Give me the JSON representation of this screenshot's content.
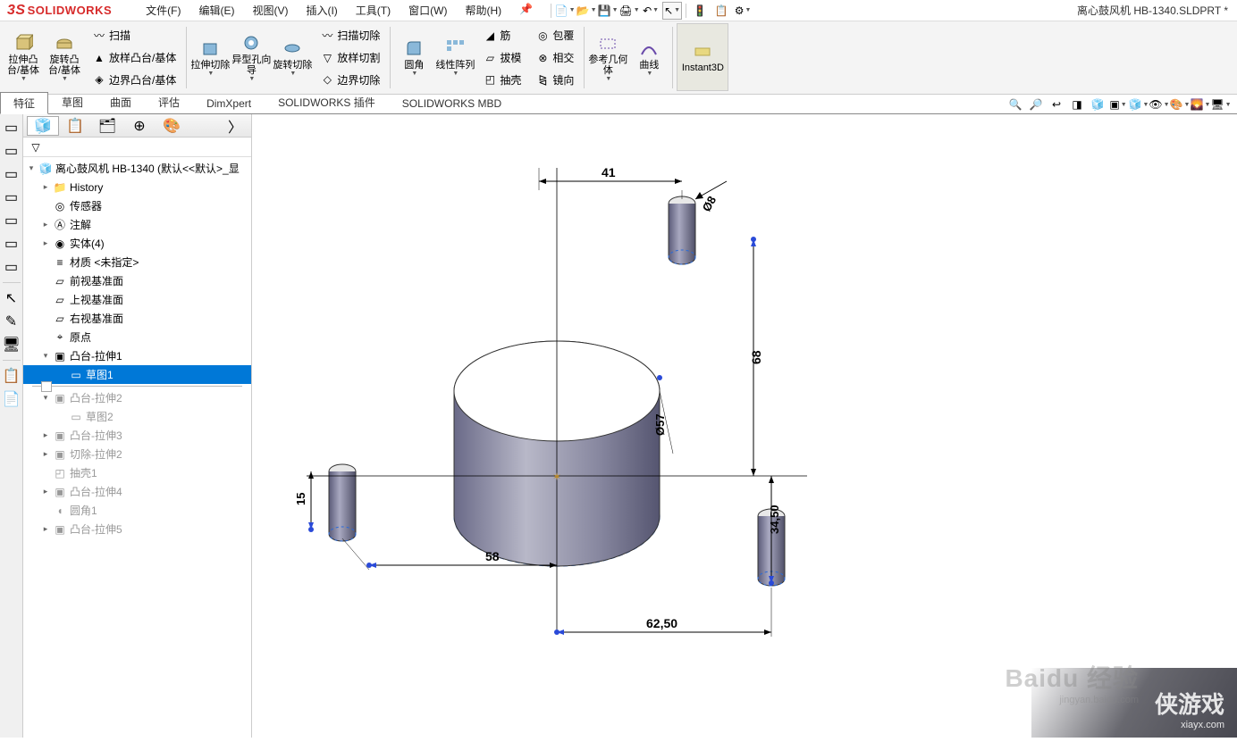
{
  "app": {
    "brand": "SOLIDWORKS",
    "document_title": "离心鼓风机 HB-1340.SLDPRT *"
  },
  "menu": {
    "file": "文件(F)",
    "edit": "编辑(E)",
    "view": "视图(V)",
    "insert": "插入(I)",
    "tools": "工具(T)",
    "window": "窗口(W)",
    "help": "帮助(H)"
  },
  "ribbon": {
    "extrude_boss": "拉伸凸台/基体",
    "revolve_boss": "旋转凸台/基体",
    "sweep": "扫描",
    "loft_boss": "放样凸台/基体",
    "boundary_boss": "边界凸台/基体",
    "extrude_cut": "拉伸切除",
    "hole_wizard": "异型孔向导",
    "revolve_cut": "旋转切除",
    "swept_cut": "扫描切除",
    "loft_cut": "放样切割",
    "boundary_cut": "边界切除",
    "fillet": "圆角",
    "linear_pattern": "线性阵列",
    "rib": "筋",
    "draft": "拔模",
    "shell": "抽壳",
    "wrap": "包覆",
    "intersect": "相交",
    "mirror": "镜向",
    "ref_geom": "参考几何体",
    "curves": "曲线",
    "instant3d": "Instant3D"
  },
  "tabs": {
    "features": "特征",
    "sketch": "草图",
    "surfaces": "曲面",
    "evaluate": "评估",
    "dimxpert": "DimXpert",
    "plugins": "SOLIDWORKS 插件",
    "mbd": "SOLIDWORKS MBD"
  },
  "tree": {
    "root": "离心鼓风机 HB-1340  (默认<<默认>_显",
    "history": "History",
    "sensors": "传感器",
    "annotations": "注解",
    "solid_bodies": "实体(4)",
    "material": "材质 <未指定>",
    "front_plane": "前视基准面",
    "top_plane": "上视基准面",
    "right_plane": "右视基准面",
    "origin": "原点",
    "boss_extrude1": "凸台-拉伸1",
    "sketch1": "草图1",
    "boss_extrude2": "凸台-拉伸2",
    "sketch2": "草图2",
    "boss_extrude3": "凸台-拉伸3",
    "cut_extrude2": "切除-拉伸2",
    "shell1": "抽壳1",
    "boss_extrude4": "凸台-拉伸4",
    "fillet1": "圆角1",
    "boss_extrude5": "凸台-拉伸5"
  },
  "dimensions": {
    "d41": "41",
    "d8": "Ø8",
    "d68": "68",
    "d57": "Ø57",
    "d3450": "34,50",
    "d6250": "62,50",
    "d58": "58",
    "d15": "15"
  },
  "watermark": {
    "baidu": "Baidu 经验",
    "baidu_url": "jingyan.baidu.com",
    "xia": "侠游戏",
    "xia_url": "xiayx.com"
  }
}
